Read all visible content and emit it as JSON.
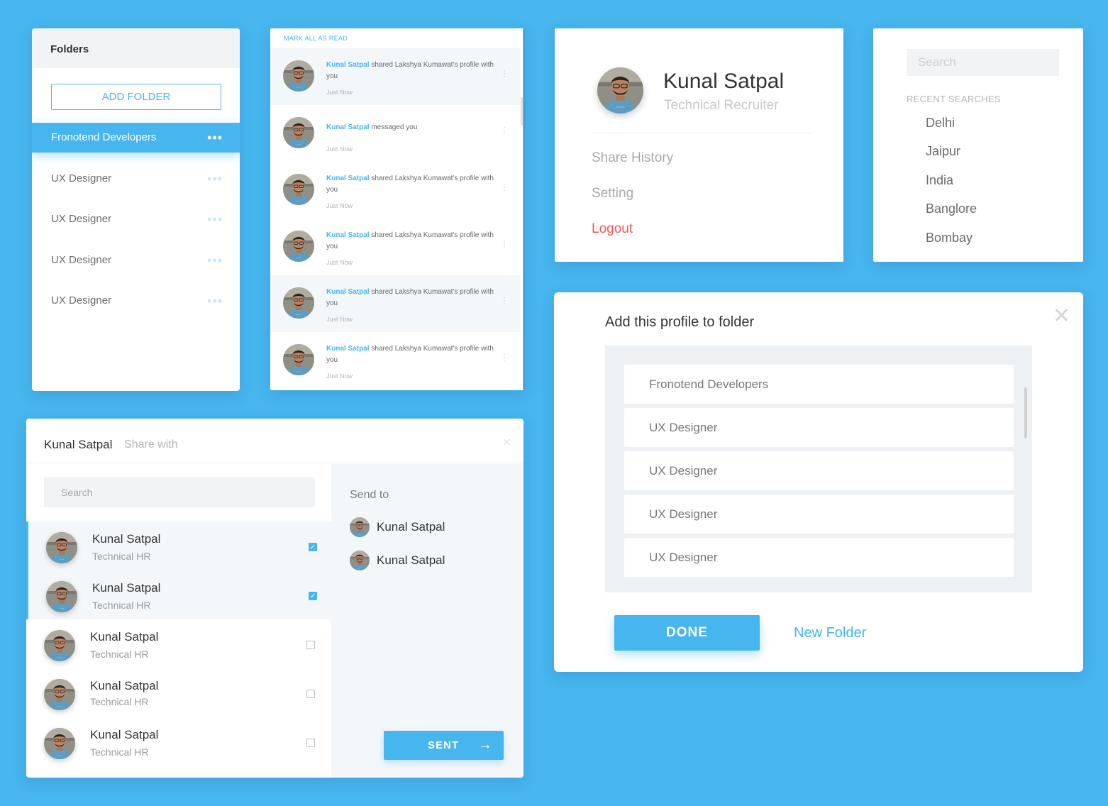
{
  "colors": {
    "background": "#47b5ee",
    "accent": "#47b5ee",
    "danger": "#f05a5a"
  },
  "folders": {
    "title": "Folders",
    "add_button": "ADD FOLDER",
    "items": [
      {
        "label": "Fronotend Developers",
        "active": true
      },
      {
        "label": "UX Designer",
        "active": false
      },
      {
        "label": "UX Designer",
        "active": false
      },
      {
        "label": "UX Designer",
        "active": false
      },
      {
        "label": "UX Designer",
        "active": false
      }
    ],
    "more_icon": "more-horizontal-icon"
  },
  "notifications": {
    "mark_all": "MARK ALL AS READ",
    "items": [
      {
        "actor": "Kunal Satpal",
        "text": " shared Lakshya Kumawat's profile with you",
        "time": "Just Now"
      },
      {
        "actor": "Kunal Satpal",
        "text": " messaged you",
        "time": "Just Now"
      },
      {
        "actor": "Kunal Satpal",
        "text": " shared Lakshya Kumawat's profile with you",
        "time": "Just Now"
      },
      {
        "actor": "Kunal Satpal",
        "text": " shared Lakshya Kumawat's profile with you",
        "time": "Just Now"
      },
      {
        "actor": "Kunal Satpal",
        "text": " shared Lakshya Kumawat's profile with you",
        "time": "Just Now"
      },
      {
        "actor": "Kunal Satpal",
        "text": " shared Lakshya Kumawat's profile with you",
        "time": "Just Now"
      }
    ]
  },
  "profile": {
    "name": "Kunal Satpal",
    "role": "Technical Recruiter",
    "menu": [
      "Share History",
      "Setting",
      "Logout"
    ]
  },
  "search": {
    "placeholder": "Search",
    "recent_title": "RECENT SEARCHES",
    "recent": [
      "Delhi",
      "Jaipur",
      "India",
      "Banglore",
      "Bombay"
    ]
  },
  "share": {
    "title": "Kunal Satpal",
    "subtitle": "Share with",
    "close_icon": "close-icon",
    "search_placeholder": "Search",
    "people": [
      {
        "name": "Kunal Satpal",
        "role": "Technical HR",
        "checked": true
      },
      {
        "name": "Kunal Satpal",
        "role": "Technical HR",
        "checked": true
      },
      {
        "name": "Kunal Satpal",
        "role": "Technical HR",
        "checked": false
      },
      {
        "name": "Kunal Satpal",
        "role": "Technical HR",
        "checked": false
      },
      {
        "name": "Kunal Satpal",
        "role": "Technical HR",
        "checked": false
      }
    ],
    "send_to_label": "Send to",
    "recipients": [
      "Kunal Satpal",
      "Kunal Satpal"
    ],
    "sent_button": "SENT",
    "arrow_icon": "arrow-right-icon"
  },
  "add_folder": {
    "title": "Add this profile to folder",
    "close_icon": "close-icon",
    "folders": [
      "Fronotend Developers",
      "UX Designer",
      "UX Designer",
      "UX Designer",
      "UX Designer"
    ],
    "done_button": "DONE",
    "new_folder": "New Folder"
  }
}
